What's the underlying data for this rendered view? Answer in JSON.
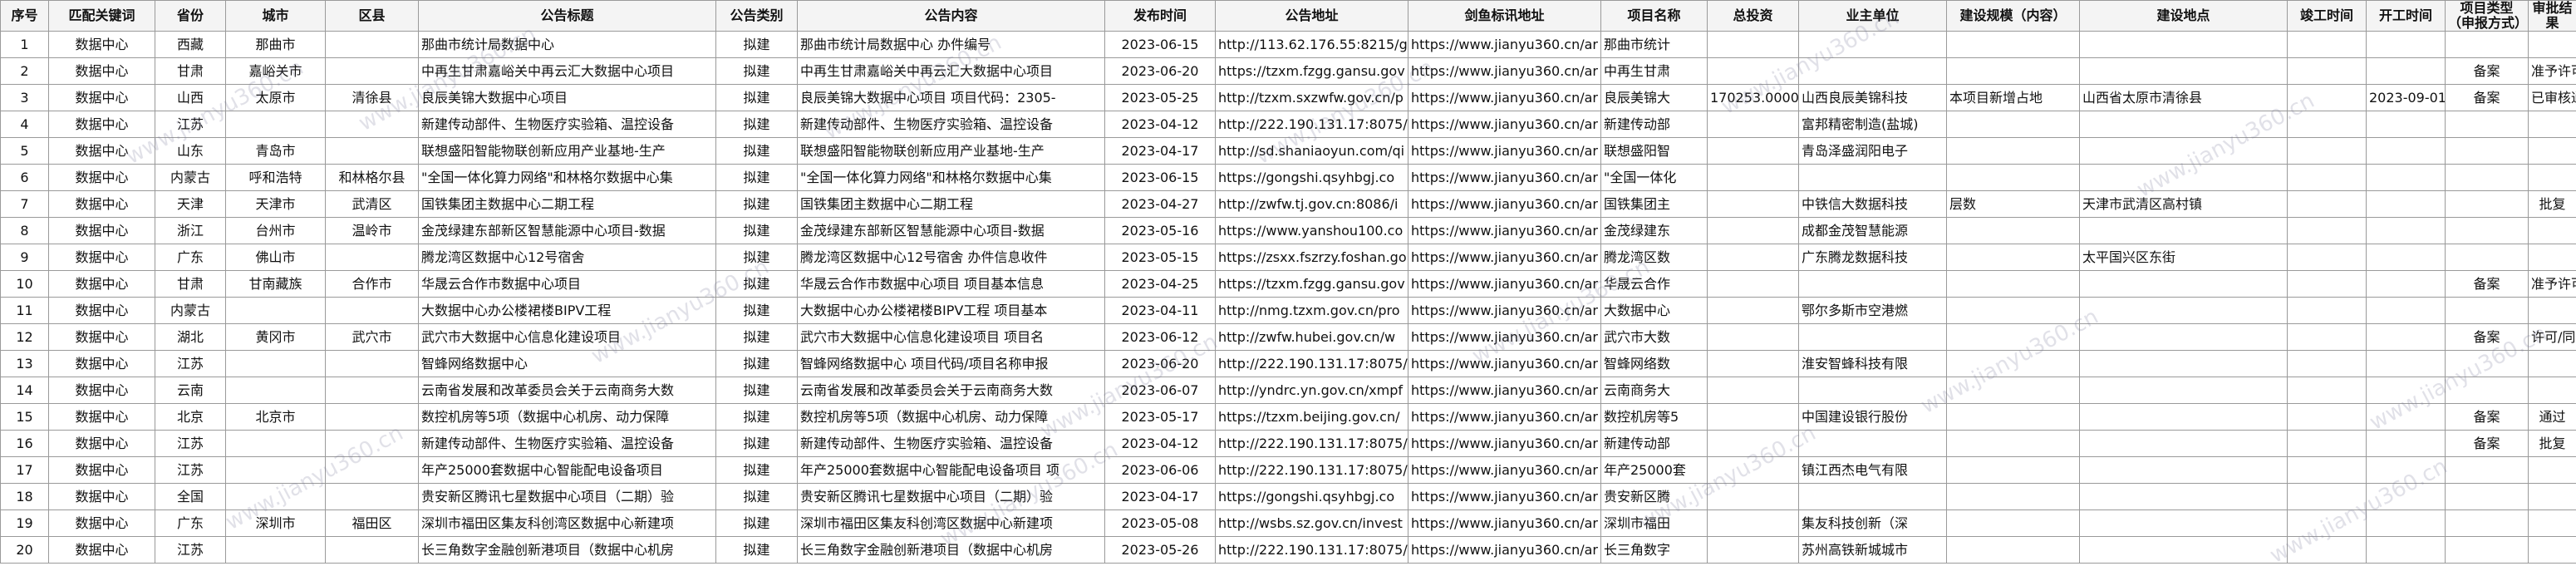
{
  "columns": [
    "序号",
    "匹配关键词",
    "省份",
    "城市",
    "区县",
    "公告标题",
    "公告类别",
    "公告内容",
    "发布时间",
    "公告地址",
    "剑鱼标讯地址",
    "项目名称",
    "总投资",
    "业主单位",
    "建设规模（内容）",
    "建设地点",
    "竣工时间",
    "开工时间",
    "项目类型（申报方式）",
    "审批结果"
  ],
  "rows": [
    [
      "1",
      "数据中心",
      "西藏",
      "那曲市",
      "",
      "那曲市统计局数据中心",
      "拟建",
      "那曲市统计局数据中心 办件编号",
      "2023-06-15",
      "http://113.62.176.55:8215/g",
      "https://www.jianyu360.cn/ar",
      "那曲市统计",
      "",
      "",
      "",
      "",
      "",
      "",
      "",
      ""
    ],
    [
      "2",
      "数据中心",
      "甘肃",
      "嘉峪关市",
      "",
      "中再生甘肃嘉峪关中再云汇大数据中心项目",
      "拟建",
      "中再生甘肃嘉峪关中再云汇大数据中心项目",
      "2023-06-20",
      "https://tzxm.fzgg.gansu.gov",
      "https://www.jianyu360.cn/ar",
      "中再生甘肃",
      "",
      "",
      "",
      "",
      "",
      "",
      "备案",
      "准予许可"
    ],
    [
      "3",
      "数据中心",
      "山西",
      "太原市",
      "清徐县",
      "良辰美锦大数据中心项目",
      "拟建",
      "良辰美锦大数据中心项目 项目代码：2305-",
      "2023-05-25",
      "http://tzxm.sxzwfw.gov.cn/p",
      "https://www.jianyu360.cn/ar",
      "良辰美锦大",
      "170253.0000",
      "山西良辰美锦科技",
      "本项目新增占地",
      "山西省太原市清徐县",
      "",
      "2023-09-01",
      "备案",
      "已审核通过"
    ],
    [
      "4",
      "数据中心",
      "江苏",
      "",
      "",
      "新建传动部件、生物医疗实验箱、温控设备",
      "拟建",
      "新建传动部件、生物医疗实验箱、温控设备",
      "2023-04-12",
      "http://222.190.131.17:8075/",
      "https://www.jianyu360.cn/ar",
      "新建传动部",
      "",
      "富邦精密制造(盐城)",
      "",
      "",
      "",
      "",
      "",
      ""
    ],
    [
      "5",
      "数据中心",
      "山东",
      "青岛市",
      "",
      "联想盛阳智能物联创新应用产业基地-生产",
      "拟建",
      "联想盛阳智能物联创新应用产业基地-生产",
      "2023-04-17",
      "http://sd.shaniaoyun.com/qi",
      "https://www.jianyu360.cn/ar",
      "联想盛阳智",
      "",
      "青岛泽盛润阳电子",
      "",
      "",
      "",
      "",
      "",
      ""
    ],
    [
      "6",
      "数据中心",
      "内蒙古",
      "呼和浩特",
      "和林格尔县",
      "\"全国一体化算力网络\"和林格尔数据中心集",
      "拟建",
      "\"全国一体化算力网络\"和林格尔数据中心集",
      "2023-06-15",
      "https://gongshi.qsyhbgj.co",
      "https://www.jianyu360.cn/ar",
      "\"全国一体化",
      "",
      "",
      "",
      "",
      "",
      "",
      "",
      ""
    ],
    [
      "7",
      "数据中心",
      "天津",
      "天津市",
      "武清区",
      "国铁集团主数据中心二期工程",
      "拟建",
      "国铁集团主数据中心二期工程",
      "2023-04-27",
      "http://zwfw.tj.gov.cn:8086/i",
      "https://www.jianyu360.cn/ar",
      "国铁集团主",
      "",
      "中铁信大数据科技",
      "层数",
      "天津市武清区高村镇",
      "",
      "",
      "",
      "批复"
    ],
    [
      "8",
      "数据中心",
      "浙江",
      "台州市",
      "温岭市",
      "金茂绿建东部新区智慧能源中心项目-数据",
      "拟建",
      "金茂绿建东部新区智慧能源中心项目-数据",
      "2023-05-16",
      "https://www.yanshou100.co",
      "https://www.jianyu360.cn/ar",
      "金茂绿建东",
      "",
      "成都金茂智慧能源",
      "",
      "",
      "",
      "",
      "",
      ""
    ],
    [
      "9",
      "数据中心",
      "广东",
      "佛山市",
      "",
      "腾龙湾区数据中心12号宿舍",
      "拟建",
      "腾龙湾区数据中心12号宿舍 办件信息收件",
      "2023-05-15",
      "https://zsxx.fszrzy.foshan.go",
      "https://www.jianyu360.cn/ar",
      "腾龙湾区数",
      "",
      "广东腾龙数据科技",
      "",
      "太平国兴区东街",
      "",
      "",
      "",
      ""
    ],
    [
      "10",
      "数据中心",
      "甘肃",
      "甘南藏族",
      "合作市",
      "华晟云合作市数据中心项目",
      "拟建",
      "华晟云合作市数据中心项目 项目基本信息",
      "2023-04-25",
      "https://tzxm.fzgg.gansu.gov",
      "https://www.jianyu360.cn/ar",
      "华晟云合作",
      "",
      "",
      "",
      "",
      "",
      "",
      "备案",
      "准予许可"
    ],
    [
      "11",
      "数据中心",
      "内蒙古",
      "",
      "",
      "大数据中心办公楼裙楼BIPV工程",
      "拟建",
      "大数据中心办公楼裙楼BIPV工程 项目基本",
      "2023-04-11",
      "http://nmg.tzxm.gov.cn/pro",
      "https://www.jianyu360.cn/ar",
      "大数据中心",
      "",
      "鄂尔多斯市空港燃",
      "",
      "",
      "",
      "",
      "",
      ""
    ],
    [
      "12",
      "数据中心",
      "湖北",
      "黄冈市",
      "武穴市",
      "武穴市大数据中心信息化建设项目",
      "拟建",
      "武穴市大数据中心信息化建设项目 项目名",
      "2023-06-12",
      "http://zwfw.hubei.gov.cn/w",
      "https://www.jianyu360.cn/ar",
      "武穴市大数",
      "",
      "",
      "",
      "",
      "",
      "",
      "备案",
      "许可/同意"
    ],
    [
      "13",
      "数据中心",
      "江苏",
      "",
      "",
      "智蜂网络数据中心",
      "拟建",
      "智蜂网络数据中心 项目代码/项目名称申报",
      "2023-06-20",
      "http://222.190.131.17:8075/",
      "https://www.jianyu360.cn/ar",
      "智蜂网络数",
      "",
      "淮安智蜂科技有限",
      "",
      "",
      "",
      "",
      "",
      ""
    ],
    [
      "14",
      "数据中心",
      "云南",
      "",
      "",
      "云南省发展和改革委员会关于云南商务大数",
      "拟建",
      "云南省发展和改革委员会关于云南商务大数",
      "2023-06-07",
      "http://yndrc.yn.gov.cn/xmpf",
      "https://www.jianyu360.cn/ar",
      "云南商务大",
      "",
      "",
      "",
      "",
      "",
      "",
      "",
      ""
    ],
    [
      "15",
      "数据中心",
      "北京",
      "北京市",
      "",
      "数控机房等5项（数据中心机房、动力保障",
      "拟建",
      "数控机房等5项（数据中心机房、动力保障",
      "2023-05-17",
      "https://tzxm.beijing.gov.cn/",
      "https://www.jianyu360.cn/ar",
      "数控机房等5",
      "",
      "中国建设银行股份",
      "",
      "",
      "",
      "",
      "备案",
      "通过"
    ],
    [
      "16",
      "数据中心",
      "江苏",
      "",
      "",
      "新建传动部件、生物医疗实验箱、温控设备",
      "拟建",
      "新建传动部件、生物医疗实验箱、温控设备",
      "2023-04-12",
      "http://222.190.131.17:8075/",
      "https://www.jianyu360.cn/ar",
      "新建传动部",
      "",
      "",
      "",
      "",
      "",
      "",
      "备案",
      "批复"
    ],
    [
      "17",
      "数据中心",
      "江苏",
      "",
      "",
      "年产25000套数据中心智能配电设备项目",
      "拟建",
      "年产25000套数据中心智能配电设备项目 项",
      "2023-06-06",
      "http://222.190.131.17:8075/",
      "https://www.jianyu360.cn/ar",
      "年产25000套",
      "",
      "镇江西杰电气有限",
      "",
      "",
      "",
      "",
      "",
      ""
    ],
    [
      "18",
      "数据中心",
      "全国",
      "",
      "",
      "贵安新区腾讯七星数据中心项目（二期）验",
      "拟建",
      "贵安新区腾讯七星数据中心项目（二期）验",
      "2023-04-17",
      "https://gongshi.qsyhbgj.co",
      "https://www.jianyu360.cn/ar",
      "贵安新区腾",
      "",
      "",
      "",
      "",
      "",
      "",
      "",
      ""
    ],
    [
      "19",
      "数据中心",
      "广东",
      "深圳市",
      "福田区",
      "深圳市福田区集友科创湾区数据中心新建项",
      "拟建",
      "深圳市福田区集友科创湾区数据中心新建项",
      "2023-05-08",
      "http://wsbs.sz.gov.cn/invest",
      "https://www.jianyu360.cn/ar",
      "深圳市福田",
      "",
      "集友科技创新（深",
      "",
      "",
      "",
      "",
      "",
      ""
    ],
    [
      "20",
      "数据中心",
      "江苏",
      "",
      "",
      "长三角数字金融创新港项目（数据中心机房",
      "拟建",
      "长三角数字金融创新港项目（数据中心机房",
      "2023-05-26",
      "http://222.190.131.17:8075/",
      "https://www.jianyu360.cn/ar",
      "长三角数字",
      "",
      "苏州高铁新城城市",
      "",
      "",
      "",
      "",
      "",
      ""
    ]
  ],
  "watermark": "www.jianyu360.cn"
}
